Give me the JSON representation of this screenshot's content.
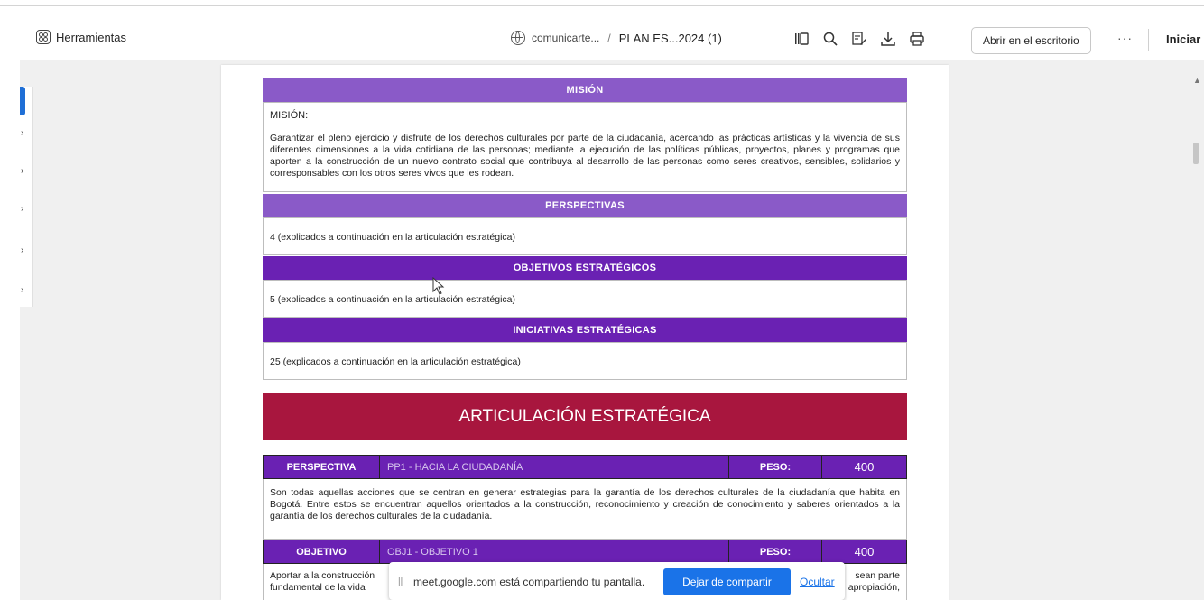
{
  "toolbar": {
    "tools_label": "Herramientas",
    "breadcrumb_site": "comunicarte...",
    "breadcrumb_sep": "/",
    "breadcrumb_doc": "PLAN ES...2024 (1)",
    "open_desktop_label": "Abrir en el escritorio",
    "more_label": "···",
    "signin_label": "Iniciar",
    "icons": [
      "reader-view-icon",
      "search-icon",
      "edit-icon",
      "download-icon",
      "print-icon"
    ]
  },
  "document": {
    "mision_header": "MISIÓN",
    "mision_label": "MISIÓN:",
    "mision_text": "Garantizar el pleno ejercicio y disfrute de los derechos culturales por parte de la ciudadanía, acercando las prácticas artísticas y la vivencia de sus diferentes dimensiones a la vida cotidiana de las personas; mediante la ejecución de las políticas públicas, proyectos, planes y programas que aporten a la construcción de un nuevo contrato social que contribuya al desarrollo de las personas como seres creativos, sensibles, solidarios y corresponsables con los otros seres vivos que les rodean.",
    "perspectivas_header": "PERSPECTIVAS",
    "perspectivas_text": "4 (explicados a continuación en la articulación estratégica)",
    "objetivos_header": "OBJETIVOS ESTRATÉGICOS",
    "objetivos_text": "5 (explicados a continuación en la articulación estratégica)",
    "iniciativas_header": "INICIATIVAS ESTRATÉGICAS",
    "iniciativas_text": "25 (explicados a continuación en la articulación estratégica)",
    "articulacion_title": "ARTICULACIÓN ESTRATÉGICA",
    "perspectiva_row": {
      "label": "PERSPECTIVA",
      "value": "PP1 - HACIA LA CIUDADANÍA",
      "peso_label": "PESO:",
      "peso_value": "400"
    },
    "perspectiva_text": "Son todas aquellas acciones que se centran en generar estrategias para la garantía de los derechos culturales de la ciudadanía que habita en Bogotá. Entre estos se encuentran aquellos orientados a la construcción, reconocimiento y creación de conocimiento y saberes orientados a la garantía de los derechos culturales de la ciudadanía.",
    "objetivo_row": {
      "label": "OBJETIVO",
      "value": "OBJ1 - OBJETIVO 1",
      "peso_label": "PESO:",
      "peso_value": "400"
    },
    "objetivo_text_left": "Aportar a la construcción fundamental de la vida",
    "objetivo_text_right": "sean parte apropiación,"
  },
  "share_bar": {
    "grip": "||",
    "message": "meet.google.com está compartiendo tu pantalla.",
    "stop_label": "Dejar de compartir",
    "hide_label": "Ocultar"
  }
}
